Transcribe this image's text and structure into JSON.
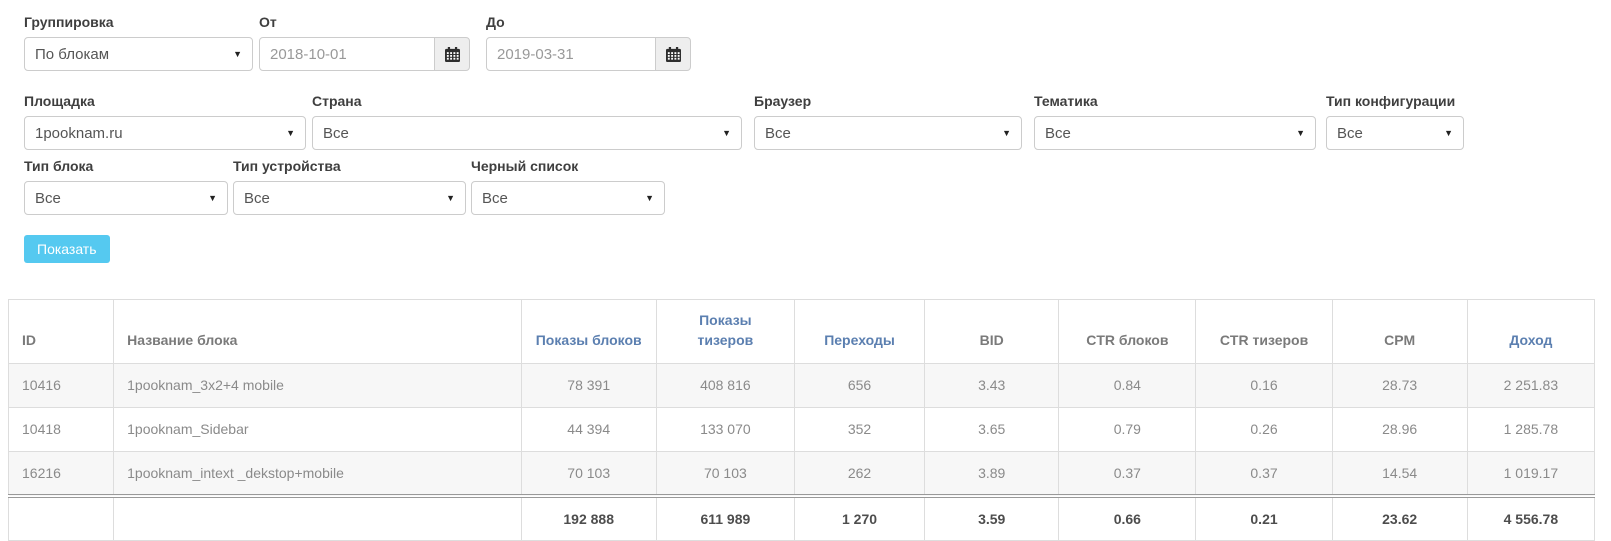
{
  "filters": [
    {
      "id": "grouping",
      "label": "Группировка",
      "type": "select",
      "value": "По блокам",
      "row": 1
    },
    {
      "id": "date-from",
      "label": "От",
      "type": "date",
      "value": "2018-10-01",
      "row": 1
    },
    {
      "id": "date-to",
      "label": "До",
      "type": "date",
      "value": "2019-03-31",
      "row": 1
    },
    {
      "id": "site",
      "label": "Площадка",
      "type": "select",
      "value": "1pooknam.ru",
      "row": 2
    },
    {
      "id": "country",
      "label": "Страна",
      "type": "select",
      "value": "Все",
      "row": 2
    },
    {
      "id": "browser",
      "label": "Браузер",
      "type": "select",
      "value": "Все",
      "row": 2
    },
    {
      "id": "theme",
      "label": "Тематика",
      "type": "select",
      "value": "Все",
      "row": 2
    },
    {
      "id": "config-type",
      "label": "Тип конфигурации",
      "type": "select",
      "value": "Все",
      "row": 2
    },
    {
      "id": "block-type",
      "label": "Тип блока",
      "type": "select",
      "value": "Все",
      "row": 3
    },
    {
      "id": "device-type",
      "label": "Тип устройства",
      "type": "select",
      "value": "Все",
      "row": 3
    },
    {
      "id": "blacklist",
      "label": "Черный список",
      "type": "select",
      "value": "Все",
      "row": 3
    }
  ],
  "show_button_label": "Показать",
  "table": {
    "columns": [
      {
        "id": "id",
        "label": "ID",
        "style": "plain",
        "align": "left"
      },
      {
        "id": "block-name",
        "label": "Название блока",
        "style": "plain",
        "align": "left"
      },
      {
        "id": "block-impressions",
        "label": "Показы блоков",
        "style": "link",
        "align": "center"
      },
      {
        "id": "teaser-impressions",
        "label": "Показы тизеров",
        "style": "link",
        "align": "center"
      },
      {
        "id": "clicks",
        "label": "Переходы",
        "style": "link",
        "align": "center"
      },
      {
        "id": "bid",
        "label": "BID",
        "style": "plain",
        "align": "center"
      },
      {
        "id": "ctr-blocks",
        "label": "CTR блоков",
        "style": "plain",
        "align": "center"
      },
      {
        "id": "ctr-teasers",
        "label": "CTR тизеров",
        "style": "plain",
        "align": "center"
      },
      {
        "id": "cpm",
        "label": "CPM",
        "style": "plain",
        "align": "center"
      },
      {
        "id": "income",
        "label": "Доход",
        "style": "link",
        "align": "center"
      }
    ],
    "rows": [
      [
        "10416",
        "1pooknam_3x2+4 mobile",
        "78 391",
        "408 816",
        "656",
        "3.43",
        "0.84",
        "0.16",
        "28.73",
        "2 251.83"
      ],
      [
        "10418",
        "1pooknam_Sidebar",
        "44 394",
        "133 070",
        "352",
        "3.65",
        "0.79",
        "0.26",
        "28.96",
        "1 285.78"
      ],
      [
        "16216",
        "1pooknam_intext _dekstop+mobile",
        "70 103",
        "70 103",
        "262",
        "3.89",
        "0.37",
        "0.37",
        "14.54",
        "1 019.17"
      ]
    ],
    "totals": [
      "",
      "",
      "192 888",
      "611 989",
      "1 270",
      "3.59",
      "0.66",
      "0.21",
      "23.62",
      "4 556.78"
    ]
  },
  "colors": {
    "accent_button": "#55c9f0",
    "link_header": "#5b7fb0",
    "plain_header": "#7a7a7a",
    "row_stripe": "#f7f7f7"
  }
}
